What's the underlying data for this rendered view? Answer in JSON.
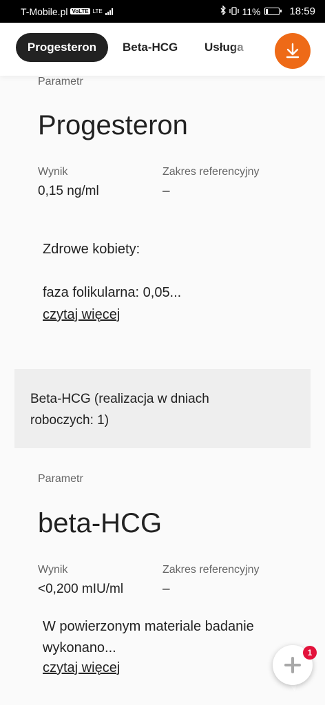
{
  "status_bar": {
    "carrier": "T-Mobile.pl",
    "volte": "VoLTE",
    "lte": "LTE",
    "battery_percent": "11%",
    "time": "18:59"
  },
  "tabs": [
    {
      "label": "Progesteron",
      "active": true
    },
    {
      "label": "Beta-HCG",
      "active": false
    },
    {
      "label": "Usługa",
      "active": false
    }
  ],
  "download_icon": "download-arrow-icon",
  "accent_color": "#ee6a17",
  "sections": [
    {
      "parameter_label": "Parametr",
      "name": "Progesteron",
      "result_label": "Wynik",
      "result_value": "0,15 ng/ml",
      "range_label": "Zakres referencyjny",
      "range_value": "–",
      "note_line1": "Zdrowe kobiety:",
      "note_line2": "faza folikularna: 0,05...",
      "read_more": "czytaj więcej"
    },
    {
      "parameter_label": "Parametr",
      "name": "beta-HCG",
      "result_label": "Wynik",
      "result_value": "<0,200 mIU/ml",
      "range_label": "Zakres referencyjny",
      "range_value": "–",
      "note_line1": "W powierzonym materiale badanie",
      "note_line2": "wykonano...",
      "read_more": "czytaj więcej"
    }
  ],
  "service_box": {
    "text": "Beta-HCG (realizacja w dniach roboczych: 1)"
  },
  "chat": {
    "icon": "plus-icon",
    "badge_count": "1",
    "badge_color": "#e3123b"
  }
}
